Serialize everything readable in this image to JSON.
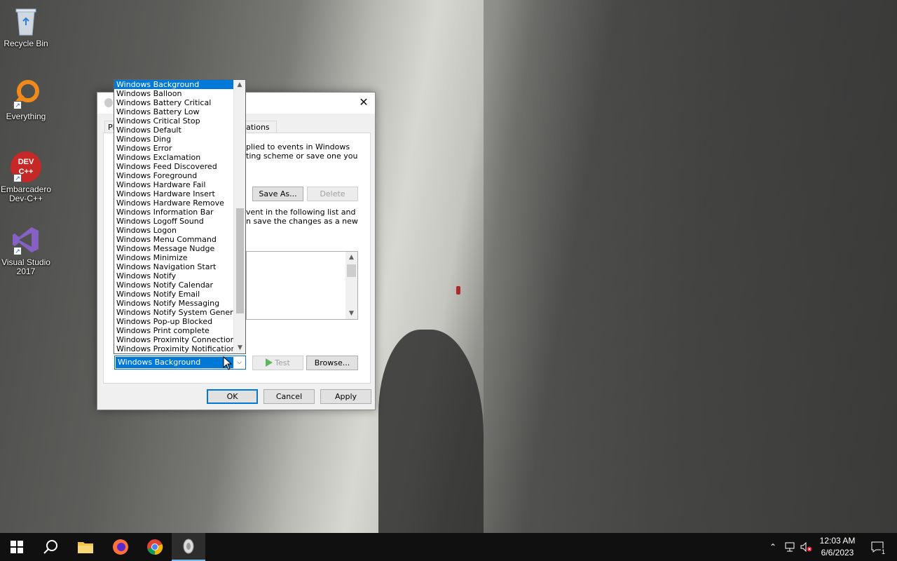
{
  "desktop": {
    "icons": [
      {
        "label": "Recycle Bin"
      },
      {
        "label": "Everything"
      },
      {
        "label": "Embarcadero Dev-C++",
        "badge_text": "DEV C++"
      },
      {
        "label": "Visual Studio 2017"
      }
    ]
  },
  "dialog": {
    "title": "",
    "close_glyph": "✕",
    "tabs": [
      {
        "label": "Pla"
      },
      {
        "label": "ications"
      }
    ],
    "scheme_text_line1": "plied to events in Windows",
    "scheme_text_line2": "ting scheme or save one you",
    "save_as_label": "Save As...",
    "delete_label": "Delete",
    "events_text_line1": "vent in the following list and",
    "events_text_line2": "n save the changes as a new",
    "test_label": "Test",
    "browse_label": "Browse...",
    "ok_label": "OK",
    "cancel_label": "Cancel",
    "apply_label": "Apply"
  },
  "sounds_combo": {
    "selected": "Windows Background",
    "options": [
      "Windows Background",
      "Windows Balloon",
      "Windows Battery Critical",
      "Windows Battery Low",
      "Windows Critical Stop",
      "Windows Default",
      "Windows Ding",
      "Windows Error",
      "Windows Exclamation",
      "Windows Feed Discovered",
      "Windows Foreground",
      "Windows Hardware Fail",
      "Windows Hardware Insert",
      "Windows Hardware Remove",
      "Windows Information Bar",
      "Windows Logoff Sound",
      "Windows Logon",
      "Windows Menu Command",
      "Windows Message Nudge",
      "Windows Minimize",
      "Windows Navigation Start",
      "Windows Notify",
      "Windows Notify Calendar",
      "Windows Notify Email",
      "Windows Notify Messaging",
      "Windows Notify System Generic",
      "Windows Pop-up Blocked",
      "Windows Print complete",
      "Windows Proximity Connection",
      "Windows Proximity Notification"
    ]
  },
  "taskbar": {
    "time": "12:03 AM",
    "date": "6/6/2023",
    "notification_count": "1",
    "accent": "#76b9ed"
  }
}
